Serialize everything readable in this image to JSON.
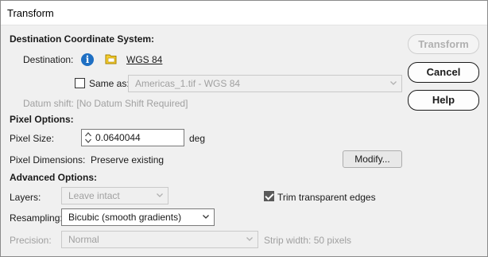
{
  "window": {
    "title": "Transform"
  },
  "destination_section": {
    "heading": "Destination Coordinate System:",
    "destination_label": "Destination:",
    "destination_value": "WGS 84",
    "same_as_label": "Same as:",
    "same_as_checked": false,
    "same_as_value": "Americas_1.tif - WGS 84",
    "datum_shift": "Datum shift: [No Datum Shift Required]"
  },
  "pixel_section": {
    "heading": "Pixel Options:",
    "pixel_size_label": "Pixel Size:",
    "pixel_size_value": "0.0640044",
    "pixel_size_unit": "deg",
    "pixel_dimensions_label": "Pixel Dimensions:",
    "pixel_dimensions_value": "Preserve existing",
    "modify_button": "Modify..."
  },
  "advanced_section": {
    "heading": "Advanced Options:",
    "layers_label": "Layers:",
    "layers_value": "Leave intact",
    "trim_label": "Trim transparent edges",
    "trim_checked": true,
    "resampling_label": "Resampling:",
    "resampling_value": "Bicubic (smooth gradients)",
    "precision_label": "Precision:",
    "precision_value": "Normal",
    "strip_width": "Strip width:  50 pixels"
  },
  "buttons": {
    "transform": "Transform",
    "cancel": "Cancel",
    "help": "Help"
  },
  "colors": {
    "info_icon": "#1e6fc3",
    "folder_icon": "#e8b800"
  }
}
